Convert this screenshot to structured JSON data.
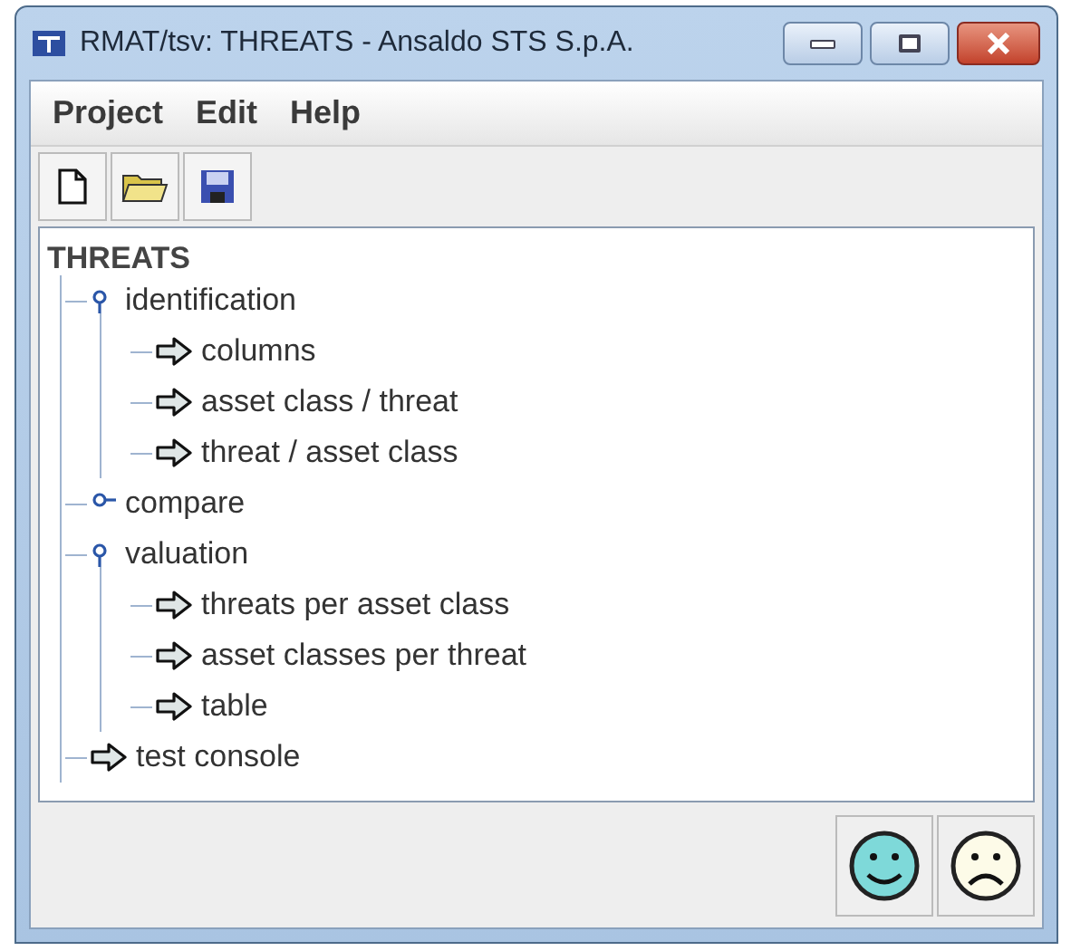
{
  "window": {
    "title": "RMAT/tsv: THREATS - Ansaldo STS S.p.A."
  },
  "menu": [
    "Project",
    "Edit",
    "Help"
  ],
  "tree": {
    "label": "THREATS",
    "children": [
      {
        "label": "identification",
        "kind": "folder",
        "expanded": true,
        "children": [
          {
            "label": "columns",
            "kind": "leaf"
          },
          {
            "label": "asset class / threat",
            "kind": "leaf"
          },
          {
            "label": "threat / asset class",
            "kind": "leaf"
          }
        ]
      },
      {
        "label": "compare",
        "kind": "folder",
        "expanded": false
      },
      {
        "label": "valuation",
        "kind": "folder",
        "expanded": true,
        "children": [
          {
            "label": "threats per asset class",
            "kind": "leaf"
          },
          {
            "label": "asset classes per threat",
            "kind": "leaf"
          },
          {
            "label": "table",
            "kind": "leaf"
          }
        ]
      },
      {
        "label": "test console",
        "kind": "leaf"
      }
    ]
  }
}
